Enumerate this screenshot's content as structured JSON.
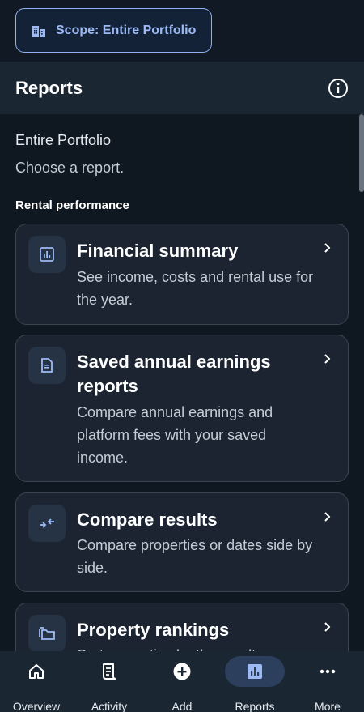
{
  "scope": {
    "label": "Scope: Entire Portfolio"
  },
  "header": {
    "title": "Reports"
  },
  "content": {
    "portfolio_name": "Entire Portfolio",
    "hint": "Choose a report.",
    "section_label": "Rental performance",
    "cards": [
      {
        "title": "Financial summary",
        "description": "See income, costs and rental use for the year."
      },
      {
        "title": "Saved annual earnings reports",
        "description": "Compare annual earnings and platform fees with your saved income."
      },
      {
        "title": "Compare results",
        "description": "Compare properties or dates side by side."
      },
      {
        "title": "Property rankings",
        "description": "Sort properties by the results..."
      }
    ]
  },
  "nav": {
    "items": [
      {
        "label": "Overview",
        "icon": "home-icon"
      },
      {
        "label": "Activity",
        "icon": "receipt-icon"
      },
      {
        "label": "Add",
        "icon": "add-circle-icon"
      },
      {
        "label": "Reports",
        "icon": "bar-chart-icon",
        "active": true
      },
      {
        "label": "More",
        "icon": "more-horizontal-icon"
      }
    ]
  },
  "colors": {
    "accent": "#9dbaf5",
    "background": "#0f1720",
    "surface": "#1b2430"
  }
}
